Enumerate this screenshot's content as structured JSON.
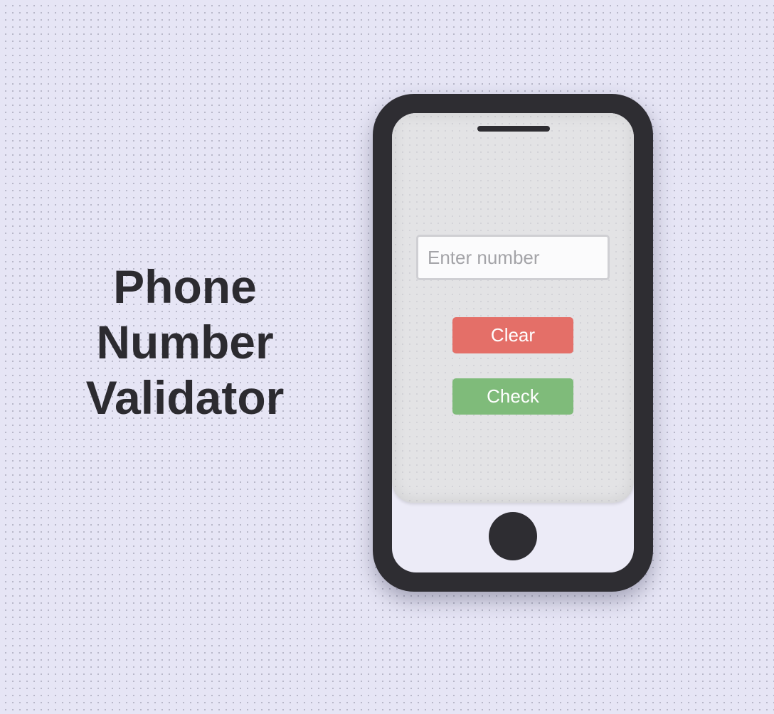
{
  "title": {
    "line1": "Phone",
    "line2": "Number",
    "line3": "Validator"
  },
  "phone": {
    "input": {
      "placeholder": "Enter number",
      "value": ""
    },
    "clear_button": {
      "label": "Clear",
      "color": "#e46f68"
    },
    "check_button": {
      "label": "Check",
      "color": "#7fbb7a"
    }
  },
  "colors": {
    "background": "#e6e5f5",
    "phone_body": "#2e2d32",
    "screen": "#e3e3e5",
    "title_text": "#2c2b30"
  }
}
